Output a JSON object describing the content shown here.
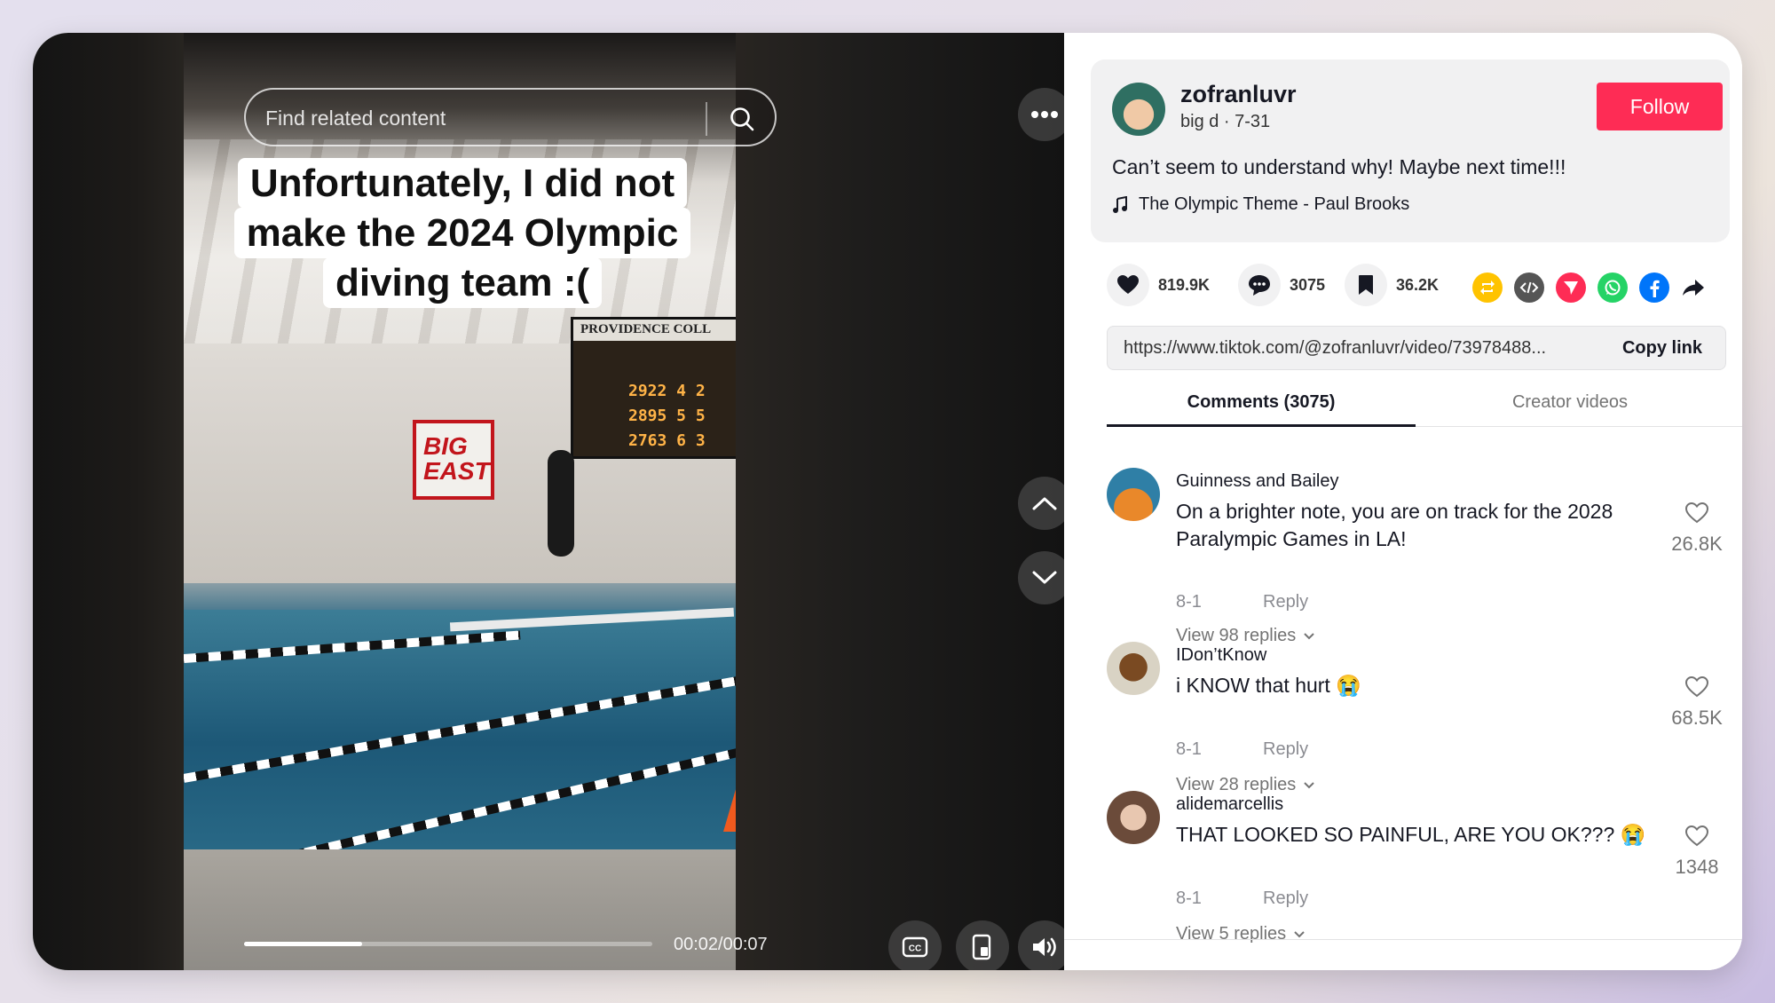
{
  "video": {
    "search_placeholder": "Find related content",
    "caption": "Unfortunately, I did not make the 2024 Olympic diving team :(",
    "time": "00:02/00:07",
    "progress": 0.29,
    "scene": {
      "scoreboard_title": "PROVIDENCE COLL",
      "scoreboard_rows": [
        "2922 4 2",
        "2895 5 5",
        "2763 6 3"
      ],
      "banner_text": "BIG EAST"
    }
  },
  "author": {
    "username": "zofranluvr",
    "subline": "big d · 7-31",
    "follow_label": "Follow",
    "description": "Can’t seem to understand why! Maybe next time!!!",
    "music": "The Olympic Theme - Paul Brooks"
  },
  "stats": {
    "likes": "819.9K",
    "comments": "3075",
    "saves": "36.2K"
  },
  "share": {
    "icons": [
      "repost-icon",
      "embed-icon",
      "send-icon",
      "whatsapp-icon",
      "facebook-icon",
      "share-arrow-icon"
    ],
    "colors": {
      "repost": "#ffc300",
      "embed": "#555555",
      "send": "#fe2c55",
      "whatsapp": "#25d366",
      "facebook": "#0075fa"
    }
  },
  "link": {
    "url": "https://www.tiktok.com/@zofranluvr/video/73978488...",
    "copy_label": "Copy link"
  },
  "tabs": [
    {
      "label": "Comments (3075)"
    },
    {
      "label": "Creator videos"
    }
  ],
  "comments": [
    {
      "user": "Guinness and Bailey",
      "text": "On a brighter note, you are on track for the 2028 Paralympic Games in LA!",
      "date": "8-1",
      "reply": "Reply",
      "view_replies": "View 98 replies",
      "likes": "26.8K"
    },
    {
      "user": "IDon’tKnow",
      "text": "i KNOW that hurt 😭",
      "date": "8-1",
      "reply": "Reply",
      "view_replies": "View 28 replies",
      "likes": "68.5K"
    },
    {
      "user": "alidemarcellis",
      "text": "THAT LOOKED SO PAINFUL, ARE YOU OK??? 😭",
      "date": "8-1",
      "reply": "Reply",
      "view_replies": "View 5 replies",
      "likes": "1348"
    }
  ],
  "colors": {
    "accent": "#fe2c55",
    "text": "#161823",
    "muted": "#8a8b91"
  }
}
